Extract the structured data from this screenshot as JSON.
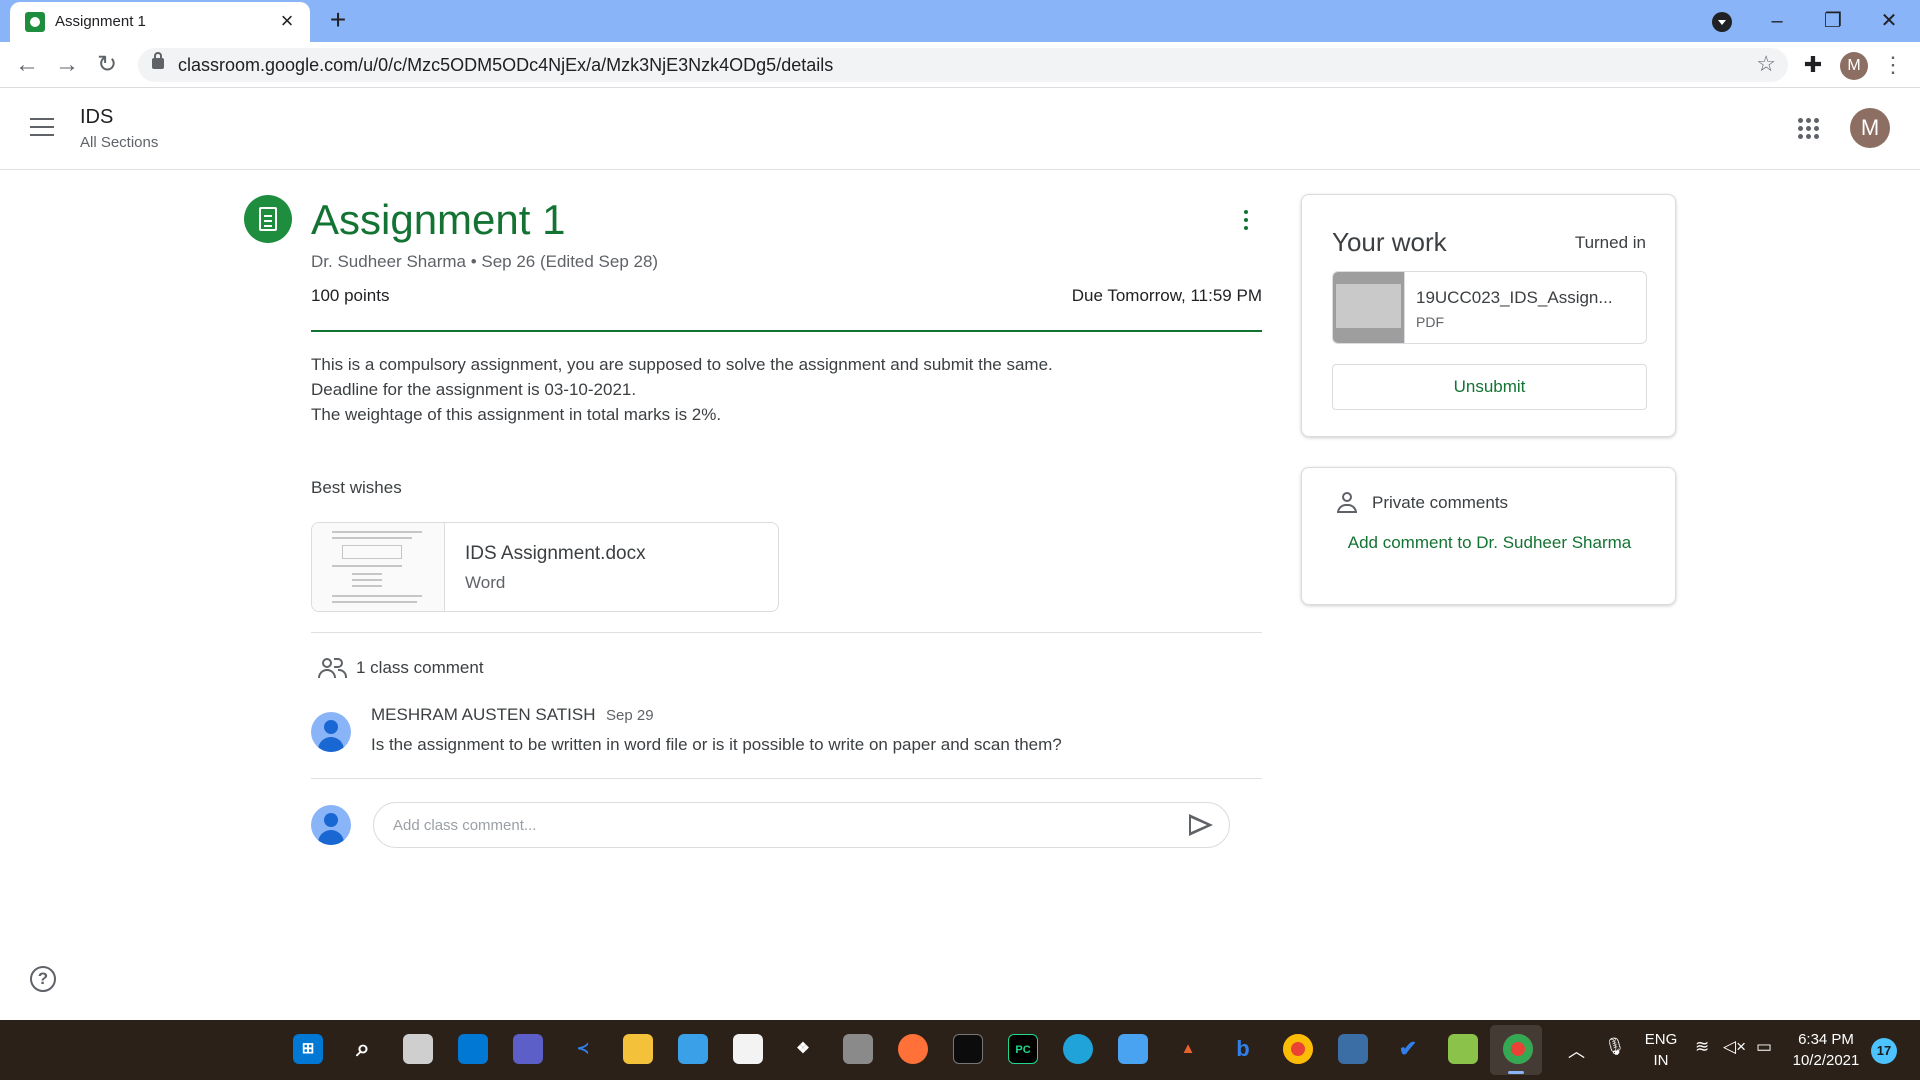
{
  "browser": {
    "tab_title": "Assignment 1",
    "url": "classroom.google.com/u/0/c/Mzc5ODM5ODc4NjEx/a/Mzk3NjE3Nzk4ODg5/details",
    "profile_initial": "M"
  },
  "header": {
    "class_name": "IDS",
    "section": "All Sections",
    "avatar_initial": "M"
  },
  "assignment": {
    "title": "Assignment 1",
    "meta": "Dr. Sudheer Sharma • Sep 26 (Edited Sep 28)",
    "points": "100 points",
    "due": "Due Tomorrow, 11:59 PM",
    "description": [
      "This is a compulsory assignment, you are supposed to solve the assignment and submit the same.",
      "Deadline for the assignment is 03-10-2021.",
      "The weightage of this assignment in total marks is 2%."
    ],
    "closing": "Best wishes",
    "attachment": {
      "name": "IDS Assignment.docx",
      "type": "Word"
    }
  },
  "comments": {
    "count_label": "1 class comment",
    "items": [
      {
        "author": "MESHRAM AUSTEN SATISH",
        "date": "Sep 29",
        "text": "Is the assignment to be written in word file or is it possible to write on paper and scan them?"
      }
    ],
    "input_placeholder": "Add class comment..."
  },
  "your_work": {
    "title": "Your work",
    "status": "Turned in",
    "file": {
      "name": "19UCC023_IDS_Assign...",
      "type": "PDF"
    },
    "unsubmit_label": "Unsubmit"
  },
  "private_comments": {
    "label": "Private comments",
    "link": "Add comment to Dr. Sudheer Sharma"
  },
  "taskbar": {
    "language": "ENG",
    "region": "IN",
    "time": "6:34 PM",
    "date": "10/2/2021",
    "notification_count": "17"
  },
  "colors": {
    "brand_green": "#137333",
    "chrome_blue": "#8ab4f8",
    "taskbar": "#2b2118"
  }
}
